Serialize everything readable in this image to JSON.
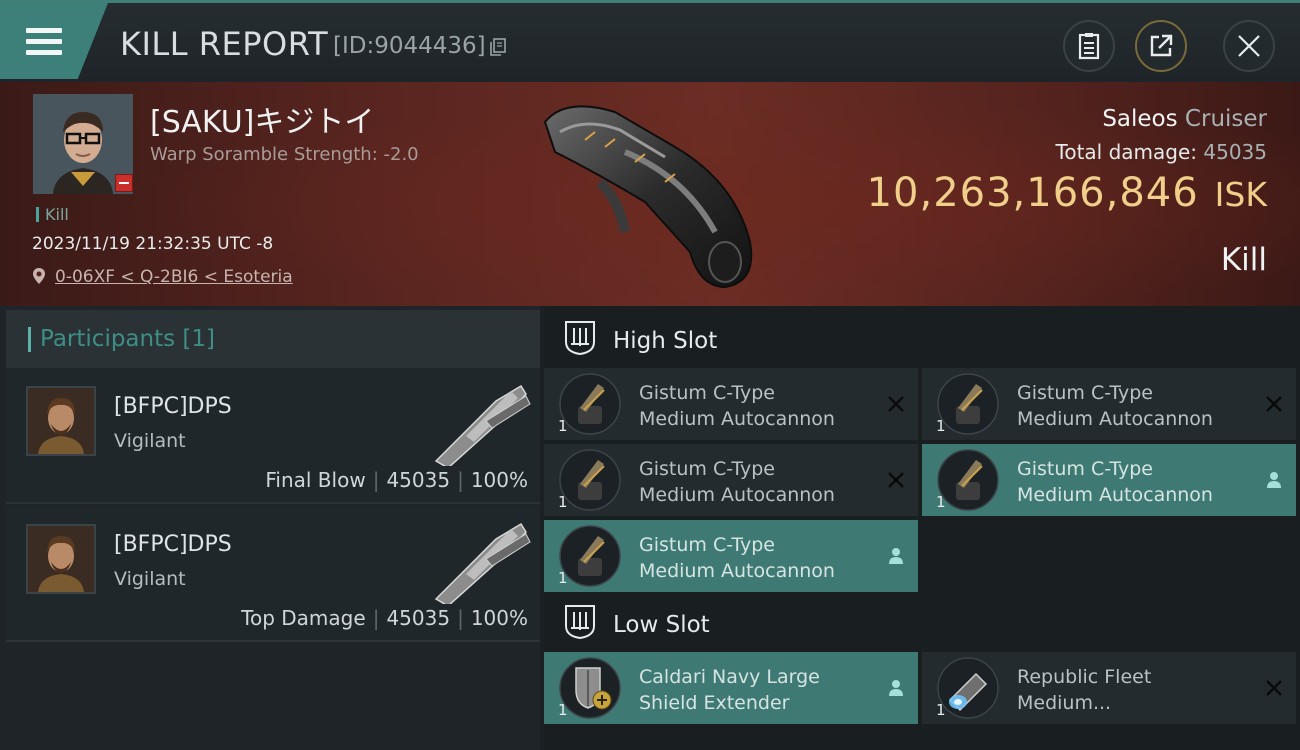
{
  "header": {
    "title": "KILL REPORT",
    "report_id": "[ID:9044436]"
  },
  "victim": {
    "name": "[SAKU]キジトイ",
    "warp_scramble": "Warp Soramble Strength: -2.0",
    "tag": "Kill",
    "datetime": "2023/11/19 21:32:35 UTC -8",
    "location": "0-06XF < Q-2BI6 < Esoteria",
    "ship_name": "Saleos",
    "ship_class": "Cruiser",
    "total_damage_label": "Total damage:",
    "total_damage_value": "45035",
    "isk_value": "10,263,166,846",
    "isk_unit": "ISK",
    "result": "Kill"
  },
  "participants": {
    "title": "Participants",
    "count": "[1]",
    "rows": [
      {
        "name": "[BFPC]DPS",
        "ship": "Vigilant",
        "role": "Final Blow",
        "damage": "45035",
        "percent": "100%"
      },
      {
        "name": "[BFPC]DPS",
        "ship": "Vigilant",
        "role": "Top Damage",
        "damage": "45035",
        "percent": "100%"
      }
    ]
  },
  "slots": {
    "high": {
      "title": "High Slot",
      "modules": [
        {
          "line1": "Gistum C-Type",
          "line2": "Medium Autocannon",
          "qty": "1",
          "state": "destroyed"
        },
        {
          "line1": "Gistum C-Type",
          "line2": "Medium Autocannon",
          "qty": "1",
          "state": "destroyed"
        },
        {
          "line1": "Gistum C-Type",
          "line2": "Medium Autocannon",
          "qty": "1",
          "state": "destroyed"
        },
        {
          "line1": "Gistum C-Type",
          "line2": "Medium Autocannon",
          "qty": "1",
          "state": "dropped"
        },
        {
          "line1": "Gistum C-Type",
          "line2": "Medium Autocannon",
          "qty": "1",
          "state": "dropped"
        }
      ]
    },
    "low": {
      "title": "Low Slot",
      "modules": [
        {
          "line1": "Caldari Navy Large",
          "line2": "Shield Extender",
          "qty": "1",
          "state": "dropped"
        },
        {
          "line1": "Republic Fleet",
          "line2": "Medium...",
          "qty": "1",
          "state": "destroyed"
        }
      ]
    }
  },
  "colors": {
    "accent": "#3e7a73",
    "isk": "#efcf8a",
    "banner": "#5a2520"
  }
}
